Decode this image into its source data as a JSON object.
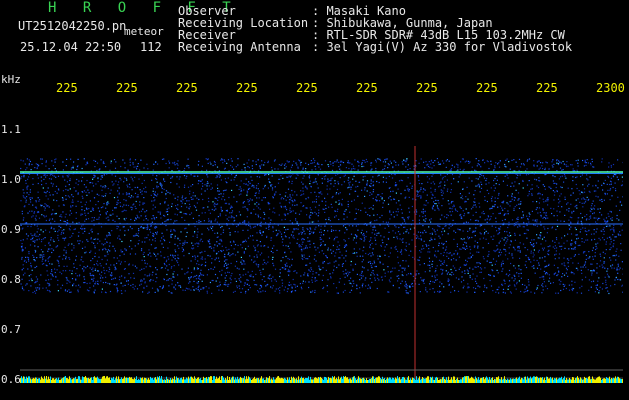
{
  "header": {
    "brand": "H R O F F T",
    "filename": "UT2512042250.pn",
    "file_type": "meteor",
    "datetime": "25.12.04 22:50",
    "count": "112",
    "info": [
      {
        "label": "Observer",
        "value": ": Masaki Kano"
      },
      {
        "label": "Receiving Location",
        "value": ": Shibukawa, Gunma, Japan"
      },
      {
        "label": "Receiver",
        "value": ": RTL-SDR SDR# 43dB L15 103.2MHz CW"
      },
      {
        "label": "Receiving Antenna",
        "value": ": 3el Yagi(V) Az 330 for Vladivostok"
      }
    ]
  },
  "axes": {
    "y_unit": "kHz",
    "y_ticks": [
      "1.1",
      "1.0",
      "0.9",
      "0.8",
      "0.7",
      "0.6"
    ],
    "x_ticks": [
      "225",
      "225",
      "225",
      "225",
      "225",
      "225",
      "225",
      "225",
      "225",
      "2300"
    ]
  },
  "colors": {
    "text": "#e8e8e8",
    "brand": "#39d353",
    "x_ticks": "#f2f200",
    "background": "#000000"
  }
}
